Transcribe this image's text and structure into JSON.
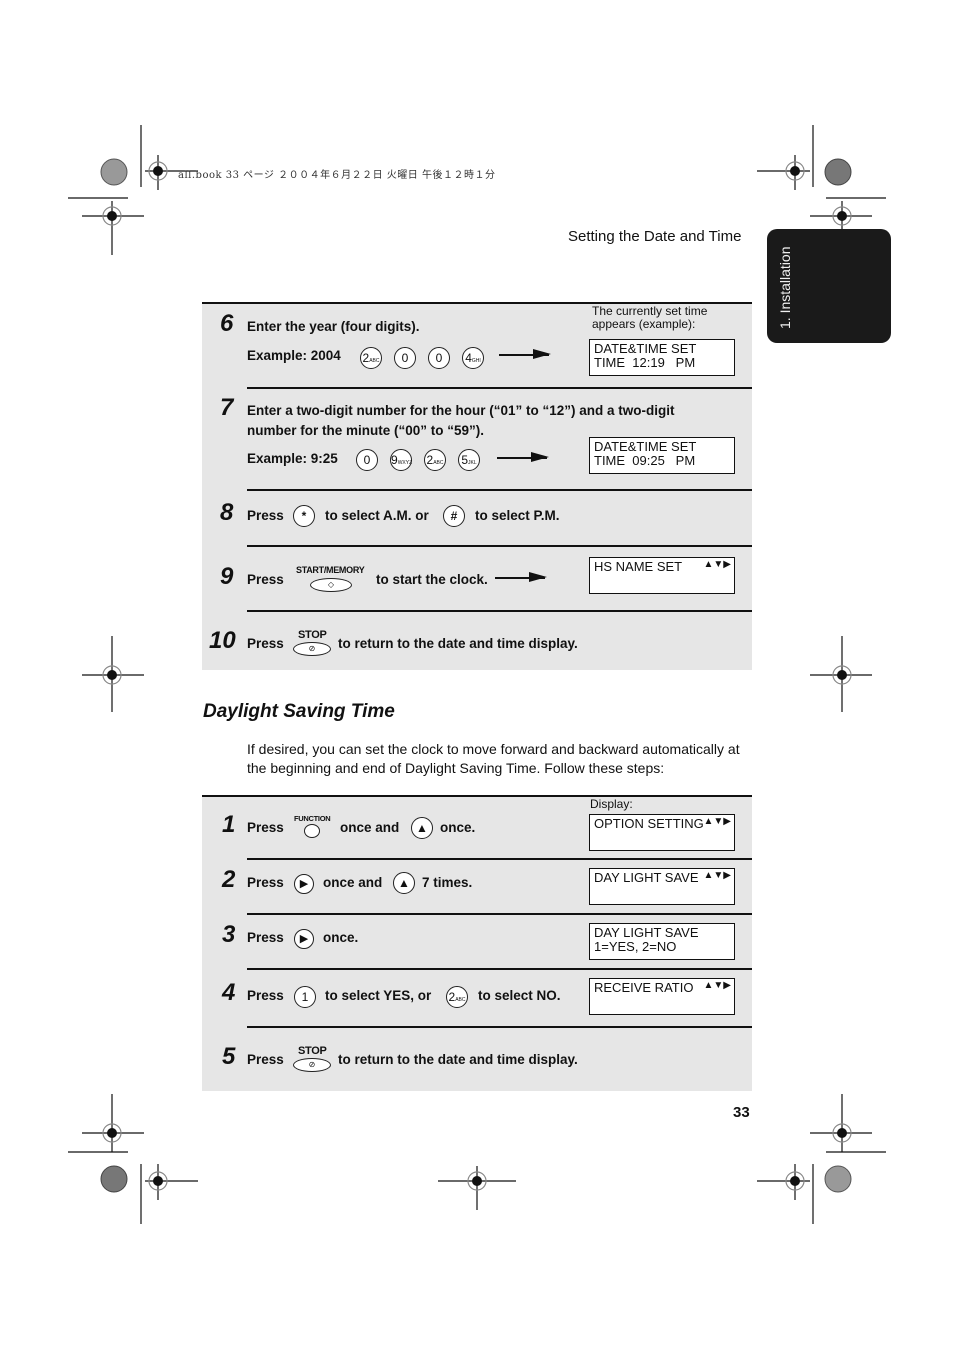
{
  "print_header": "all.book  33 ページ  ２００４年６月２２日  火曜日  午後１２時１分",
  "running_head": "Setting the Date and Time",
  "side_tab": "1. Installation",
  "steps_top": [
    {
      "num": "6",
      "text": "Enter the year (four digits).",
      "example_label": "Example: 2004",
      "keys": [
        {
          "main": "2",
          "sub": "ABC"
        },
        {
          "main": "0",
          "sub": ""
        },
        {
          "main": "0",
          "sub": ""
        },
        {
          "main": "4",
          "sub": "GHI"
        }
      ],
      "note": "The currently set time appears (example):",
      "display": [
        "DATE&TIME SET",
        "TIME  12:19   PM"
      ]
    },
    {
      "num": "7",
      "text_line1": "Enter a two-digit number for the hour (“01” to “12”) and a two-digit",
      "text_line2": "number for the minute (“00” to “59”).",
      "example_label": "Example: 9:25",
      "keys": [
        {
          "main": "0",
          "sub": ""
        },
        {
          "main": "9",
          "sub": "WXYZ"
        },
        {
          "main": "2",
          "sub": "ABC"
        },
        {
          "main": "5",
          "sub": "JKL"
        }
      ],
      "display": [
        "DATE&TIME SET",
        "TIME  09:25   PM"
      ]
    },
    {
      "num": "8",
      "press": "Press",
      "key1": "*",
      "mid": "to select A.M. or",
      "key2": "#",
      "end": "to select P.M."
    },
    {
      "num": "9",
      "press": "Press",
      "key_label": "START/MEMORY",
      "end": "to start the clock.",
      "display": [
        "HS NAME SET"
      ]
    },
    {
      "num": "10",
      "press": "Press",
      "key_label": "STOP",
      "end": "to return to the date and time display."
    }
  ],
  "section_title": "Daylight Saving Time",
  "intro": "If desired, you can set the clock to move forward and backward automatically at the beginning and end of Daylight Saving Time. Follow these steps:",
  "display_label": "Display:",
  "steps_dst": [
    {
      "num": "1",
      "press": "Press",
      "key_label": "FUNCTION",
      "mid": "once and",
      "end": "once.",
      "display": [
        "OPTION SETTING"
      ]
    },
    {
      "num": "2",
      "press": "Press",
      "mid": "once and",
      "end": "7 times.",
      "display": [
        "DAY LIGHT SAVE"
      ]
    },
    {
      "num": "3",
      "press": "Press",
      "end": "once.",
      "display": [
        "DAY LIGHT SAVE",
        "1=YES, 2=NO"
      ]
    },
    {
      "num": "4",
      "press": "Press",
      "key1": "1",
      "mid": "to select YES, or",
      "key2": "2",
      "key2_sub": "ABC",
      "end": "to select NO.",
      "display": [
        "RECEIVE RATIO"
      ]
    },
    {
      "num": "5",
      "press": "Press",
      "key_label": "STOP",
      "end": "to return to the date and time display."
    }
  ],
  "page_number": "33",
  "icons": {
    "updown": "▲▼▶",
    "start": "◇",
    "stop": "⊘"
  }
}
